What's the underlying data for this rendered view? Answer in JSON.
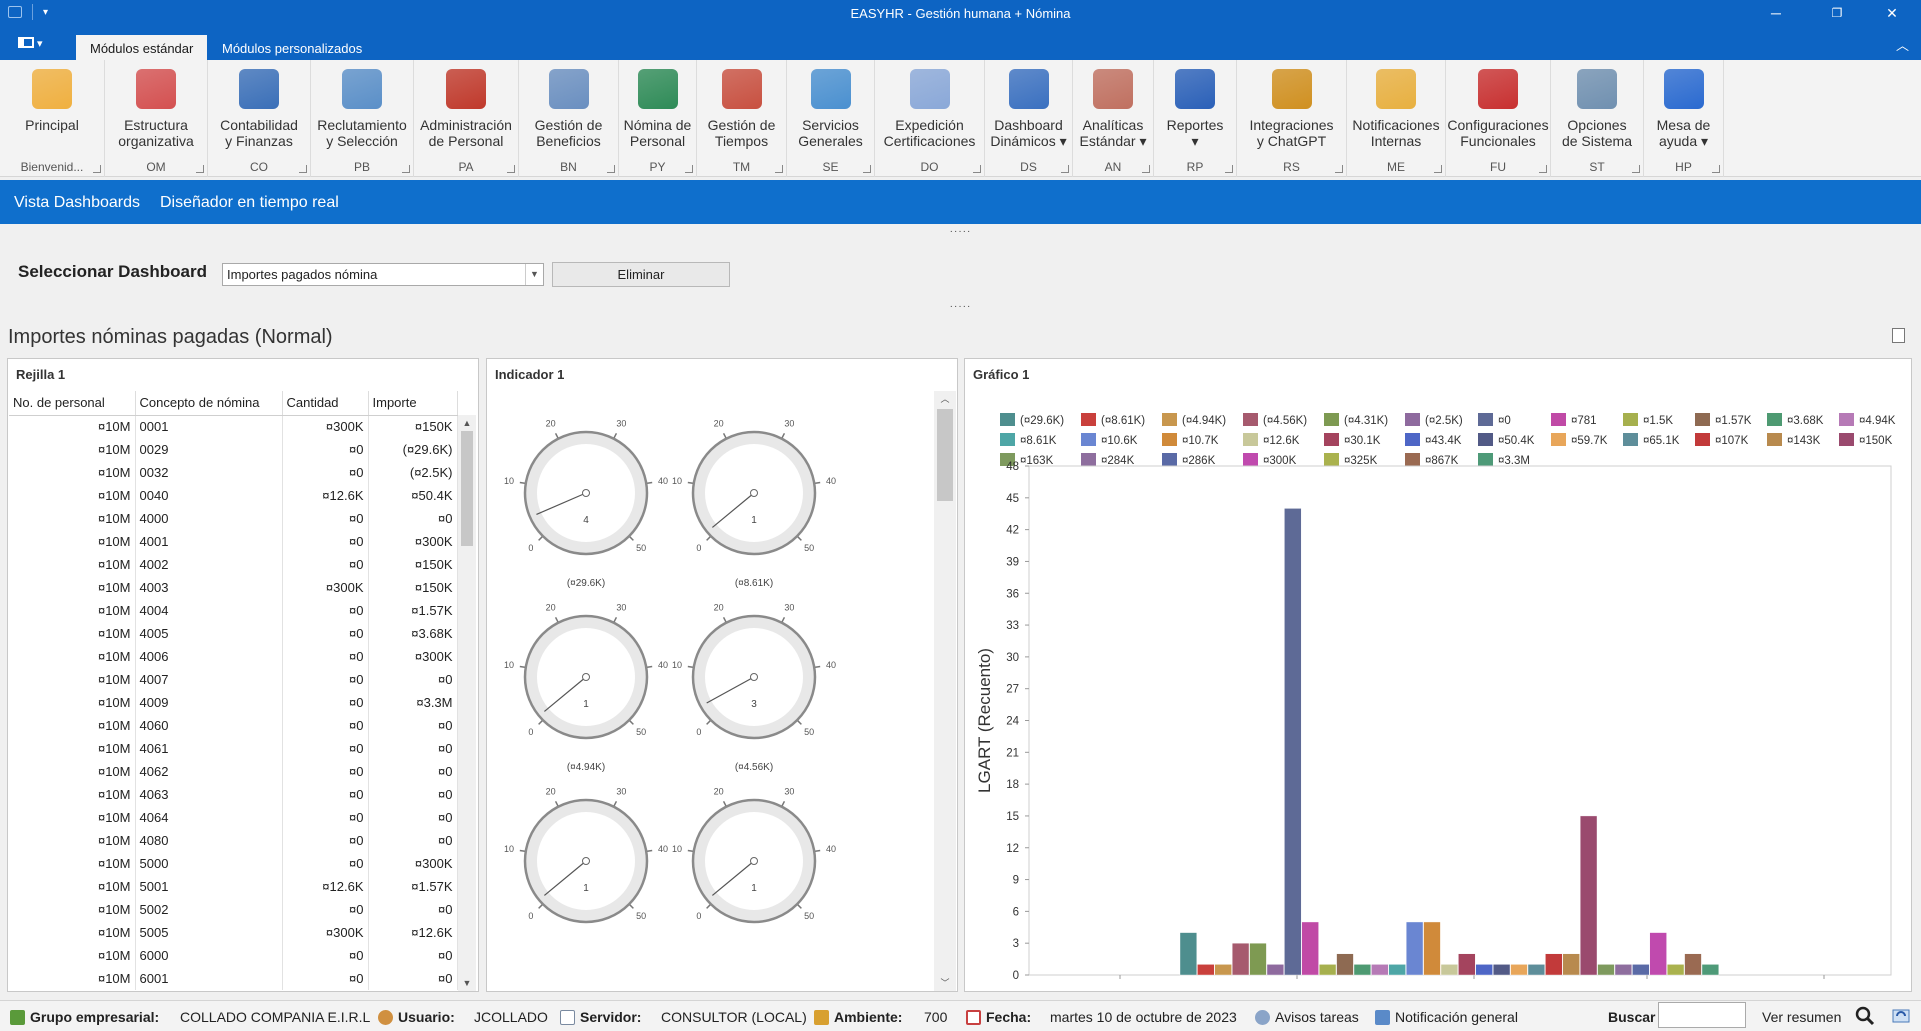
{
  "window": {
    "title": "EASYHR - Gestión humana + Nómina",
    "qat": "▾",
    "minimize": "─",
    "restore": "❐",
    "close": "✕"
  },
  "tabs": [
    {
      "label": "Módulos estándar"
    },
    {
      "label": "Módulos personalizados"
    }
  ],
  "ribbon_groups": [
    {
      "label": "Principal",
      "group": "Bienvenid...",
      "color": "#f0b040"
    },
    {
      "label": "Estructura\norganizativa",
      "group": "OM",
      "color": "#d45050"
    },
    {
      "label": "Contabilidad\ny Finanzas",
      "group": "CO",
      "color": "#3a6fb8"
    },
    {
      "label": "Reclutamiento\ny Selección",
      "group": "PB",
      "color": "#5a8fc8"
    },
    {
      "label": "Administración\nde Personal",
      "group": "PA",
      "color": "#c0392b"
    },
    {
      "label": "Gestión de\nBeneficios",
      "group": "BN",
      "color": "#6a8fc0"
    },
    {
      "label": "Nómina de\nPersonal",
      "group": "PY",
      "color": "#2e8b57"
    },
    {
      "label": "Gestión de\nTiempos",
      "group": "TM",
      "color": "#c85040"
    },
    {
      "label": "Servicios\nGenerales",
      "group": "SE",
      "color": "#4a90d0"
    },
    {
      "label": "Expedición\nCertificaciones",
      "group": "DO",
      "color": "#8aa8d8"
    },
    {
      "label": "Dashboard\nDinámicos ▾",
      "group": "DS",
      "color": "#3a70c0"
    },
    {
      "label": "Analíticas\nEstándar ▾",
      "group": "AN",
      "color": "#c07060"
    },
    {
      "label": "Reportes\n▾",
      "group": "RP",
      "color": "#2a60b8"
    },
    {
      "label": "Integraciones\ny ChatGPT",
      "group": "RS",
      "color": "#d09020"
    },
    {
      "label": "Notificaciones\nInternas",
      "group": "ME",
      "color": "#e8b040"
    },
    {
      "label": "Configuraciones\nFuncionales",
      "group": "FU",
      "color": "#c83030"
    },
    {
      "label": "Opciones\nde Sistema",
      "group": "ST",
      "color": "#7090b0"
    },
    {
      "label": "Mesa de\nayuda ▾",
      "group": "HP",
      "color": "#2a6ad0"
    }
  ],
  "dashbar": {
    "view": "Vista Dashboards",
    "designer": "Diseñador en tiempo real"
  },
  "grip": "·····",
  "selector": {
    "label": "Seleccionar Dashboard",
    "value": "Importes pagados nómina",
    "delete_label": "Eliminar"
  },
  "dashboard_title": "Importes nóminas pagadas (Normal)",
  "grid_panel": {
    "title": "Rejilla 1",
    "columns": [
      "No. de personal",
      "Concepto de nómina",
      "Cantidad",
      "Importe"
    ],
    "rows": [
      [
        "¤10M",
        "0001",
        "¤300K",
        "¤150K"
      ],
      [
        "¤10M",
        "0029",
        "¤0",
        "(¤29.6K)"
      ],
      [
        "¤10M",
        "0032",
        "¤0",
        "(¤2.5K)"
      ],
      [
        "¤10M",
        "0040",
        "¤12.6K",
        "¤50.4K"
      ],
      [
        "¤10M",
        "4000",
        "¤0",
        "¤0"
      ],
      [
        "¤10M",
        "4001",
        "¤0",
        "¤300K"
      ],
      [
        "¤10M",
        "4002",
        "¤0",
        "¤150K"
      ],
      [
        "¤10M",
        "4003",
        "¤300K",
        "¤150K"
      ],
      [
        "¤10M",
        "4004",
        "¤0",
        "¤1.57K"
      ],
      [
        "¤10M",
        "4005",
        "¤0",
        "¤3.68K"
      ],
      [
        "¤10M",
        "4006",
        "¤0",
        "¤300K"
      ],
      [
        "¤10M",
        "4007",
        "¤0",
        "¤0"
      ],
      [
        "¤10M",
        "4009",
        "¤0",
        "¤3.3M"
      ],
      [
        "¤10M",
        "4060",
        "¤0",
        "¤0"
      ],
      [
        "¤10M",
        "4061",
        "¤0",
        "¤0"
      ],
      [
        "¤10M",
        "4062",
        "¤0",
        "¤0"
      ],
      [
        "¤10M",
        "4063",
        "¤0",
        "¤0"
      ],
      [
        "¤10M",
        "4064",
        "¤0",
        "¤0"
      ],
      [
        "¤10M",
        "4080",
        "¤0",
        "¤0"
      ],
      [
        "¤10M",
        "5000",
        "¤0",
        "¤300K"
      ],
      [
        "¤10M",
        "5001",
        "¤12.6K",
        "¤1.57K"
      ],
      [
        "¤10M",
        "5002",
        "¤0",
        "¤0"
      ],
      [
        "¤10M",
        "5005",
        "¤300K",
        "¤12.6K"
      ],
      [
        "¤10M",
        "6000",
        "¤0",
        "¤0"
      ],
      [
        "¤10M",
        "6001",
        "¤0",
        "¤0"
      ]
    ]
  },
  "indicator_panel": {
    "title": "Indicador 1",
    "ticks": [
      "0",
      "10",
      "20",
      "30",
      "40",
      "50"
    ],
    "gauges": [
      {
        "value": 4,
        "caption": "(¤29.6K)"
      },
      {
        "value": 1,
        "caption": "(¤8.61K)"
      },
      {
        "value": 1,
        "caption": "(¤4.94K)"
      },
      {
        "value": 3,
        "caption": "(¤4.56K)"
      },
      {
        "value": 1,
        "caption": ""
      },
      {
        "value": 1,
        "caption": ""
      }
    ]
  },
  "chart_panel": {
    "title": "Gráfico 1"
  },
  "chart_data": {
    "type": "bar",
    "ylabel": "LGART (Recuento)",
    "ylim": [
      0,
      48
    ],
    "yticks": [
      0,
      3,
      6,
      9,
      12,
      15,
      18,
      21,
      24,
      27,
      30,
      33,
      36,
      39,
      42,
      45,
      48
    ],
    "grid": false,
    "legend_position": "top",
    "series": [
      {
        "name": "(¤29.6K)",
        "value": 4,
        "color": "#4e8e8e"
      },
      {
        "name": "(¤8.61K)",
        "value": 1,
        "color": "#c9403c"
      },
      {
        "name": "(¤4.94K)",
        "value": 1,
        "color": "#c8974e"
      },
      {
        "name": "(¤4.56K)",
        "value": 3,
        "color": "#a65a6e"
      },
      {
        "name": "(¤4.31K)",
        "value": 3,
        "color": "#7e9a52"
      },
      {
        "name": "(¤2.5K)",
        "value": 1,
        "color": "#8e6a9e"
      },
      {
        "name": "¤0",
        "value": 44,
        "color": "#5e6a96"
      },
      {
        "name": "¤781",
        "value": 5,
        "color": "#c04aa6"
      },
      {
        "name": "¤1.5K",
        "value": 1,
        "color": "#a6b04e"
      },
      {
        "name": "¤1.57K",
        "value": 2,
        "color": "#8e6a52"
      },
      {
        "name": "¤3.68K",
        "value": 1,
        "color": "#4e9a72"
      },
      {
        "name": "¤4.94K",
        "value": 1,
        "color": "#b67ab6"
      },
      {
        "name": "¤8.61K",
        "value": 1,
        "color": "#4ea6a6"
      },
      {
        "name": "¤10.6K",
        "value": 5,
        "color": "#6a86d2"
      },
      {
        "name": "¤10.7K",
        "value": 5,
        "color": "#d08a3a"
      },
      {
        "name": "¤12.6K",
        "value": 1,
        "color": "#c8c89a"
      },
      {
        "name": "¤30.1K",
        "value": 2,
        "color": "#a4445e"
      },
      {
        "name": "¤43.4K",
        "value": 1,
        "color": "#4e66c6"
      },
      {
        "name": "¤50.4K",
        "value": 1,
        "color": "#525a86"
      },
      {
        "name": "¤59.7K",
        "value": 1,
        "color": "#e8a65a"
      },
      {
        "name": "¤65.1K",
        "value": 1,
        "color": "#5e8e9a"
      },
      {
        "name": "¤107K",
        "value": 2,
        "color": "#c23a3a"
      },
      {
        "name": "¤143K",
        "value": 2,
        "color": "#b88a4e"
      },
      {
        "name": "¤150K",
        "value": 15,
        "color": "#9a4a6e"
      },
      {
        "name": "¤163K",
        "value": 1,
        "color": "#7e9a5e"
      },
      {
        "name": "¤284K",
        "value": 1,
        "color": "#8e6e9e"
      },
      {
        "name": "¤286K",
        "value": 1,
        "color": "#5a6aa6"
      },
      {
        "name": "¤300K",
        "value": 4,
        "color": "#c04aae"
      },
      {
        "name": "¤325K",
        "value": 1,
        "color": "#aab24e"
      },
      {
        "name": "¤867K",
        "value": 2,
        "color": "#9a6a52"
      },
      {
        "name": "¤3.3M",
        "value": 1,
        "color": "#4e9a78"
      }
    ]
  },
  "statusbar": {
    "company_label": "Grupo empresarial:",
    "company": "COLLADO  COMPANIA E.I.R.L",
    "user_label": "Usuario:",
    "user": "JCOLLADO",
    "server_label": "Servidor:",
    "server": "CONSULTOR (LOCAL)",
    "env_label": "Ambiente:",
    "env": "700",
    "date_label": "Fecha:",
    "date": "martes 10 de octubre de 2023",
    "tasks": "Avisos tareas",
    "notif": "Notificación general",
    "search_label": "Buscar",
    "summary": "Ver resumen"
  }
}
